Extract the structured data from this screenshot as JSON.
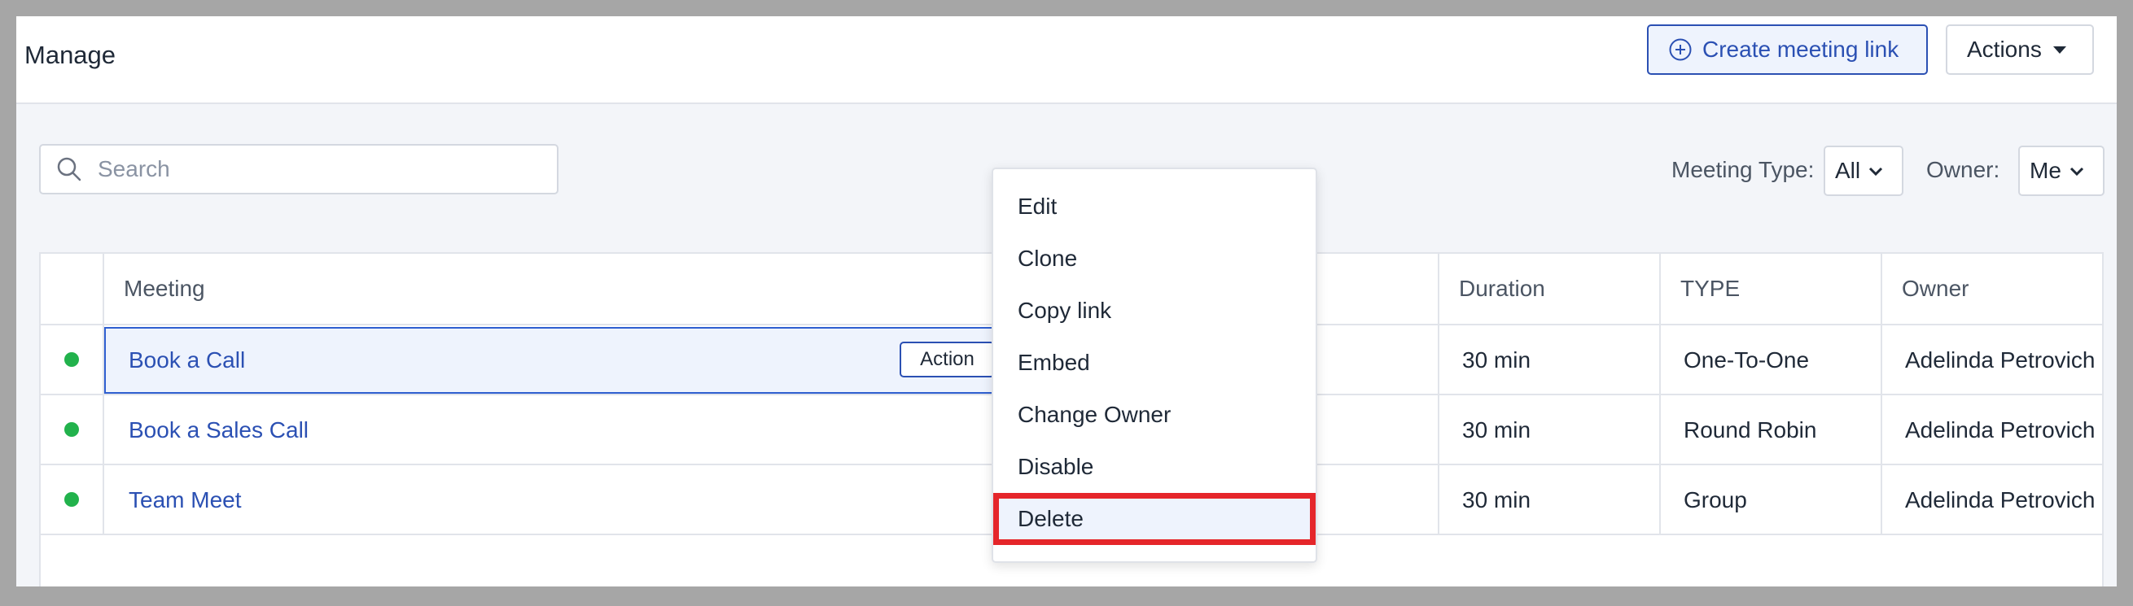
{
  "header": {
    "title": "Manage",
    "create_button": "Create meeting link",
    "actions_button": "Actions"
  },
  "search": {
    "placeholder": "Search",
    "value": ""
  },
  "filters": {
    "meeting_type_label": "Meeting Type:",
    "meeting_type_value": "All",
    "owner_label": "Owner:",
    "owner_value": "Me"
  },
  "table": {
    "columns": [
      "Meeting",
      "Duration",
      "TYPE",
      "Owner"
    ],
    "rows": [
      {
        "status": "active",
        "meeting": "Book a Call",
        "duration": "30 min",
        "type": "One-To-One",
        "owner": "Adelinda Petrovich",
        "selected": true
      },
      {
        "status": "active",
        "meeting": "Book a Sales Call",
        "duration": "30 min",
        "type": "Round Robin",
        "owner": "Adelinda Petrovich"
      },
      {
        "status": "active",
        "meeting": "Team Meet",
        "duration": "30 min",
        "type": "Group",
        "owner": "Adelinda Petrovich"
      }
    ],
    "row_action_label": "Action"
  },
  "context_menu": {
    "items": [
      "Edit",
      "Clone",
      "Copy link",
      "Embed",
      "Change Owner",
      "Disable",
      "Delete"
    ],
    "highlighted": "Delete"
  },
  "colors": {
    "accent": "#2b50b3",
    "status_active": "#22b24c",
    "highlight_border": "#e5262a"
  }
}
